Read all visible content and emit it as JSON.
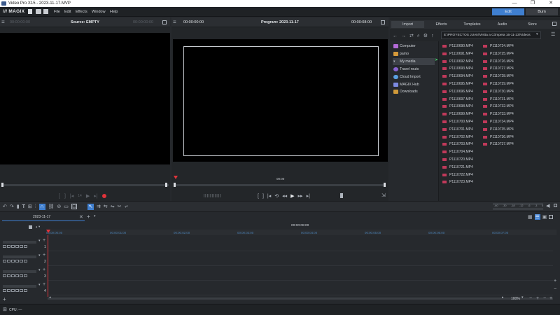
{
  "window": {
    "title": "Video Pro X15 - 2023-11-17.MVP",
    "minimize": "—",
    "maximize": "❐",
    "close": "✕"
  },
  "menu": {
    "logo": "/// MAGIX",
    "items": [
      "File",
      "Edit",
      "Effects",
      "Window",
      "Help"
    ],
    "edit_mode": "Edit",
    "burn_mode": "Burn"
  },
  "source_monitor": {
    "timecode_left": "00:00:00:00",
    "title": "Source: EMPTY",
    "timecode_right": "00:00:00:00",
    "frame_counter": "14"
  },
  "program_monitor": {
    "timecode_left": "00:00:00:00",
    "title": "Program: 2023-11-17",
    "timecode_right": "00:00:08:00",
    "scrub_time": "00:00"
  },
  "media_pool": {
    "tabs": [
      "Import",
      "Effects",
      "Templates",
      "Audio",
      "Store"
    ],
    "active_tab": "Import",
    "path": "E:\\PROYECTOS JUAN\\Visita a Cómpeta 16-11-23\\Videos",
    "tree": [
      {
        "label": "Computer",
        "icon": "computer-icon",
        "color": "#b36ad6"
      },
      {
        "label": "pamo",
        "icon": "user-icon",
        "color": "#d59a3a"
      },
      {
        "label": "My media",
        "icon": "folder-icon",
        "color": "#6d7178"
      },
      {
        "label": "Travel routs",
        "icon": "map-pin-icon",
        "color": "#8a63d2"
      },
      {
        "label": "Cloud Import",
        "icon": "cloud-icon",
        "color": "#5aa0e0"
      },
      {
        "label": "MAGIX Hub",
        "icon": "hub-icon",
        "color": "#7c8ae0"
      },
      {
        "label": "Downloads",
        "icon": "download-icon",
        "color": "#d09a3a"
      }
    ],
    "files_col1": [
      "P1110690.MP4",
      "P1110691.MP4",
      "P1110692.MP4",
      "P1110693.MP4",
      "P1110694.MP4",
      "P1110695.MP4",
      "P1110696.MP4",
      "P1110697.MP4",
      "P1110698.MP4",
      "P1110699.MP4",
      "P1110700.MP4",
      "P1110701.MP4",
      "P1110702.MP4",
      "P1110703.MP4",
      "P1110704.MP4",
      "P1110720.MP4",
      "P1110721.MP4",
      "P1110722.MP4",
      "P1110723.MP4"
    ],
    "files_col2": [
      "P1110724.MP4",
      "P1110725.MP4",
      "P1110726.MP4",
      "P1110727.MP4",
      "P1110728.MP4",
      "P1110729.MP4",
      "P1110730.MP4",
      "P1110731.MP4",
      "P1110732.MP4",
      "P1110733.MP4",
      "P1110734.MP4",
      "P1110735.MP4",
      "P1110736.MP4",
      "P1110737.MP4"
    ]
  },
  "timeline": {
    "tab_name": "2023-11-17",
    "position": "00:00:08:00",
    "ruler": [
      "00:00:00:00",
      "00:00:01:00",
      "00:00:02:00",
      "00:00:03:00",
      "00:00:04:00",
      "00:00:05:00",
      "00:00:06:00",
      "00:00:07:00"
    ],
    "track_numbers": [
      "1",
      "2",
      "3",
      "4"
    ],
    "meter_ticks": [
      "-60",
      "-30",
      "-18",
      "-12",
      "-6",
      "-3",
      "0"
    ],
    "zoom": "100%"
  },
  "status": {
    "cpu": "CPU: —"
  }
}
